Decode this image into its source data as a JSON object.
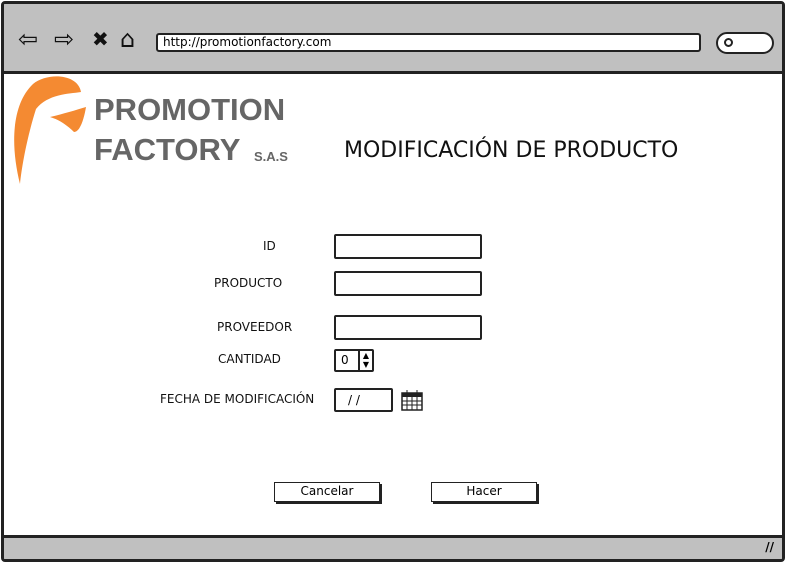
{
  "browser": {
    "url": "http://promotionfactory.com",
    "back": "⇦",
    "forward": "⇨",
    "stop": "✖",
    "home": "⌂"
  },
  "logo": {
    "line1": "PROMOTION",
    "line2": "FACTORY",
    "suffix": "S.A.S",
    "brand_color": "#f48a32"
  },
  "page_title": "MODIFICACIÓN DE PRODUCTO",
  "form": {
    "id_label": "ID",
    "id_value": "",
    "producto_label": "PRODUCTO",
    "producto_value": "",
    "proveedor_label": "PROVEEDOR",
    "proveedor_value": "",
    "cantidad_label": "CANTIDAD",
    "cantidad_value": "0",
    "fecha_label": "FECHA DE MODIFICACIÓN",
    "fecha_value": "/ /"
  },
  "buttons": {
    "cancel": "Cancelar",
    "submit": "Hacer"
  }
}
